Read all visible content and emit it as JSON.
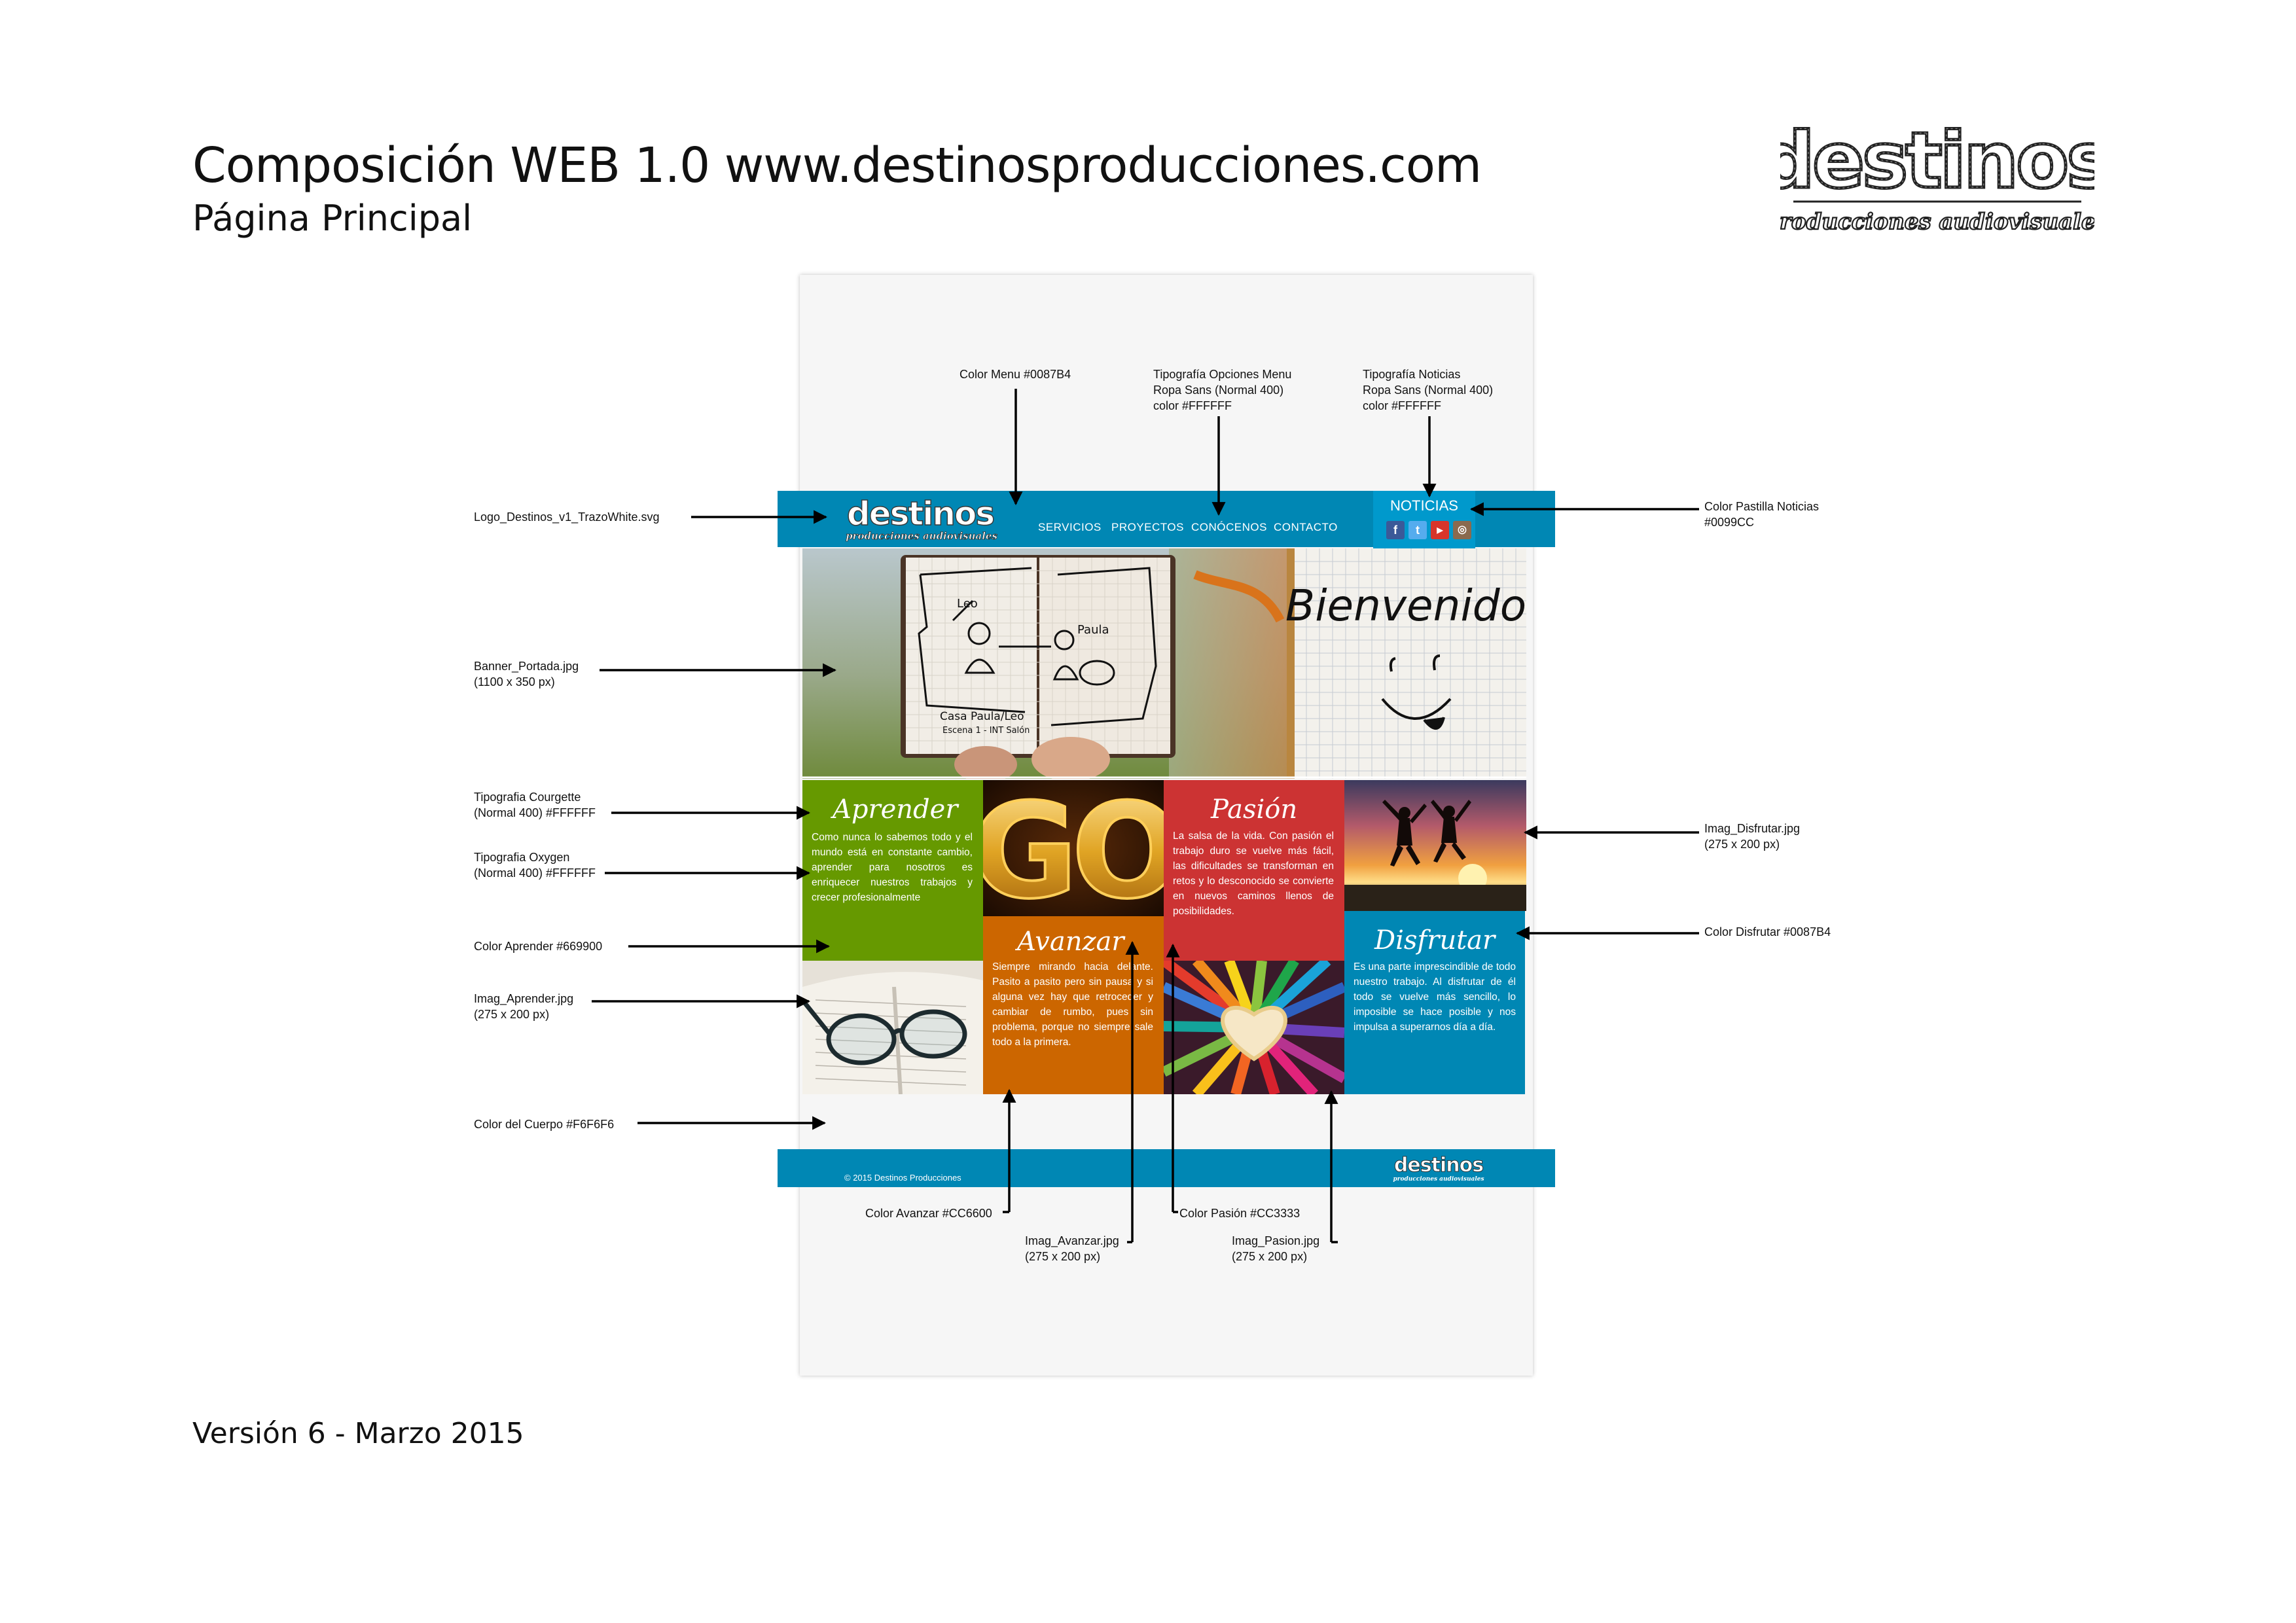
{
  "sheet": {
    "title": "Composición WEB 1.0 www.destinosproducciones.com",
    "subtitle": "Página Principal",
    "version": "Versión 6 - Marzo 2015",
    "brand_name": "destinos",
    "brand_tagline": "producciones audiovisuales"
  },
  "colors": {
    "menu": "#0087B4",
    "noticias": "#0099CC",
    "aprender": "#669900",
    "avanzar": "#CC6600",
    "pasion": "#CC3333",
    "disfrutar": "#0087B4",
    "body": "#F6F6F6"
  },
  "mockup": {
    "logo_name": "destinos",
    "logo_tagline": "producciones audiovisuales",
    "menu": [
      "SERVICIOS",
      "PROYECTOS",
      "CONÓCENOS",
      "CONTACTO"
    ],
    "noticias_label": "NOTICIAS",
    "social_icons": [
      "facebook-icon",
      "twitter-icon",
      "youtube-icon",
      "instagram-icon"
    ],
    "banner": {
      "notebook_text_1": "Leo",
      "notebook_text_2": "Paula",
      "notebook_text_3": "Casa Paula/Leo",
      "notebook_text_4": "Escena 1 - INT Salón",
      "welcome": "Bienvenido"
    },
    "tiles": {
      "aprender": {
        "title": "Aprender",
        "text": "Como nunca lo sabemos todo y el mundo está en constante cambio, aprender para nosotros es enriquecer nuestros trabajos y crecer profesionalmente"
      },
      "go_image_text": "GO",
      "pasion": {
        "title": "Pasión",
        "text": "La salsa de la vida. Con pasión el trabajo duro se vuelve más fácil, las dificultades se transforman en retos y lo desconocido se convierte en nuevos caminos llenos de posibilidades."
      },
      "avanzar": {
        "title": "Avanzar",
        "text": "Siempre mirando hacia delante. Pasito a pasito pero sin pausa y si alguna vez hay que retroceder y cambiar de rumbo, pues sin problema, porque no siempre sale todo a la primera."
      },
      "disfrutar": {
        "title": "Disfrutar",
        "text": "Es una parte imprescindible de todo nuestro trabajo. Al disfrutar de él todo se vuelve más sencillo, lo imposible se hace posible y nos impulsa a superarnos día a día."
      }
    },
    "footer_copy": "© 2015 Destinos Producciones",
    "footer_logo_name": "destinos",
    "footer_logo_tagline": "producciones audiovisuales"
  },
  "annotations": {
    "color_menu": "Color Menu #0087B4",
    "tipo_menu_1": "Tipografía Opciones Menu",
    "tipo_menu_2": "Ropa Sans (Normal 400)",
    "tipo_menu_3": "color #FFFFFF",
    "tipo_noticias_1": "Tipografía Noticias",
    "tipo_noticias_2": "Ropa Sans (Normal 400)",
    "tipo_noticias_3": "color #FFFFFF",
    "logo_file": "Logo_Destinos_v1_TrazoWhite.svg",
    "pastilla_1": "Color Pastilla Noticias",
    "pastilla_2": "#0099CC",
    "banner_1": "Banner_Portada.jpg",
    "banner_2": "(1100 x 350 px)",
    "courgette_1": "Tipografia Courgette",
    "courgette_2": "(Normal 400) #FFFFFF",
    "oxygen_1": "Tipografia Oxygen",
    "oxygen_2": "(Normal 400) #FFFFFF",
    "color_aprender": "Color Aprender #669900",
    "img_aprender_1": "Imag_Aprender.jpg",
    "img_aprender_2": "(275 x 200 px)",
    "color_cuerpo": "Color del Cuerpo #F6F6F6",
    "img_disfrutar_1": "Imag_Disfrutar.jpg",
    "img_disfrutar_2": "(275 x 200 px)",
    "color_disfrutar": "Color Disfrutar #0087B4",
    "color_avanzar": "Color Avanzar #CC6600",
    "color_pasion": "Color Pasión #CC3333",
    "img_avanzar_1": "Imag_Avanzar.jpg",
    "img_avanzar_2": "(275 x 200 px)",
    "img_pasion_1": "Imag_Pasion.jpg",
    "img_pasion_2": "(275 x 200 px)"
  }
}
